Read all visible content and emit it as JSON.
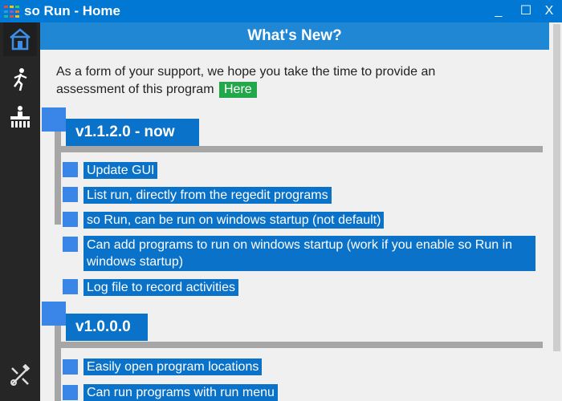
{
  "window": {
    "title": "so Run - Home",
    "controls": {
      "minimize": "_",
      "maximize": "☐",
      "close": "X"
    }
  },
  "sidebar": {
    "items": [
      {
        "name": "home",
        "icon": "home-icon"
      },
      {
        "name": "run",
        "icon": "runner-icon"
      },
      {
        "name": "startup",
        "icon": "hurdle-icon"
      },
      {
        "name": "settings",
        "icon": "settings-icon"
      }
    ]
  },
  "header": {
    "title": "What's New?"
  },
  "intro": {
    "text": "As a form of your support, we hope you take the time to provide an assessment of this program",
    "link_label": "Here"
  },
  "versions": [
    {
      "title": "v1.1.2.0 - now",
      "items": [
        "Update GUI",
        "List run, directly from the regedit programs",
        "so Run, can be run on windows startup (not default)",
        "Can add programs to run on windows startup (work if you enable so Run in windows startup)",
        "Log file to record activities"
      ]
    },
    {
      "title": "v1.0.0.0",
      "items": [
        "Easily open program locations",
        "Can run programs with run menu"
      ]
    }
  ],
  "colors": {
    "titlebar": "#0078d4",
    "header": "#1f87d3",
    "item_bg": "#0a72c8",
    "marker": "#3a86e8",
    "link": "#22a84b",
    "sidebar": "#262626"
  }
}
